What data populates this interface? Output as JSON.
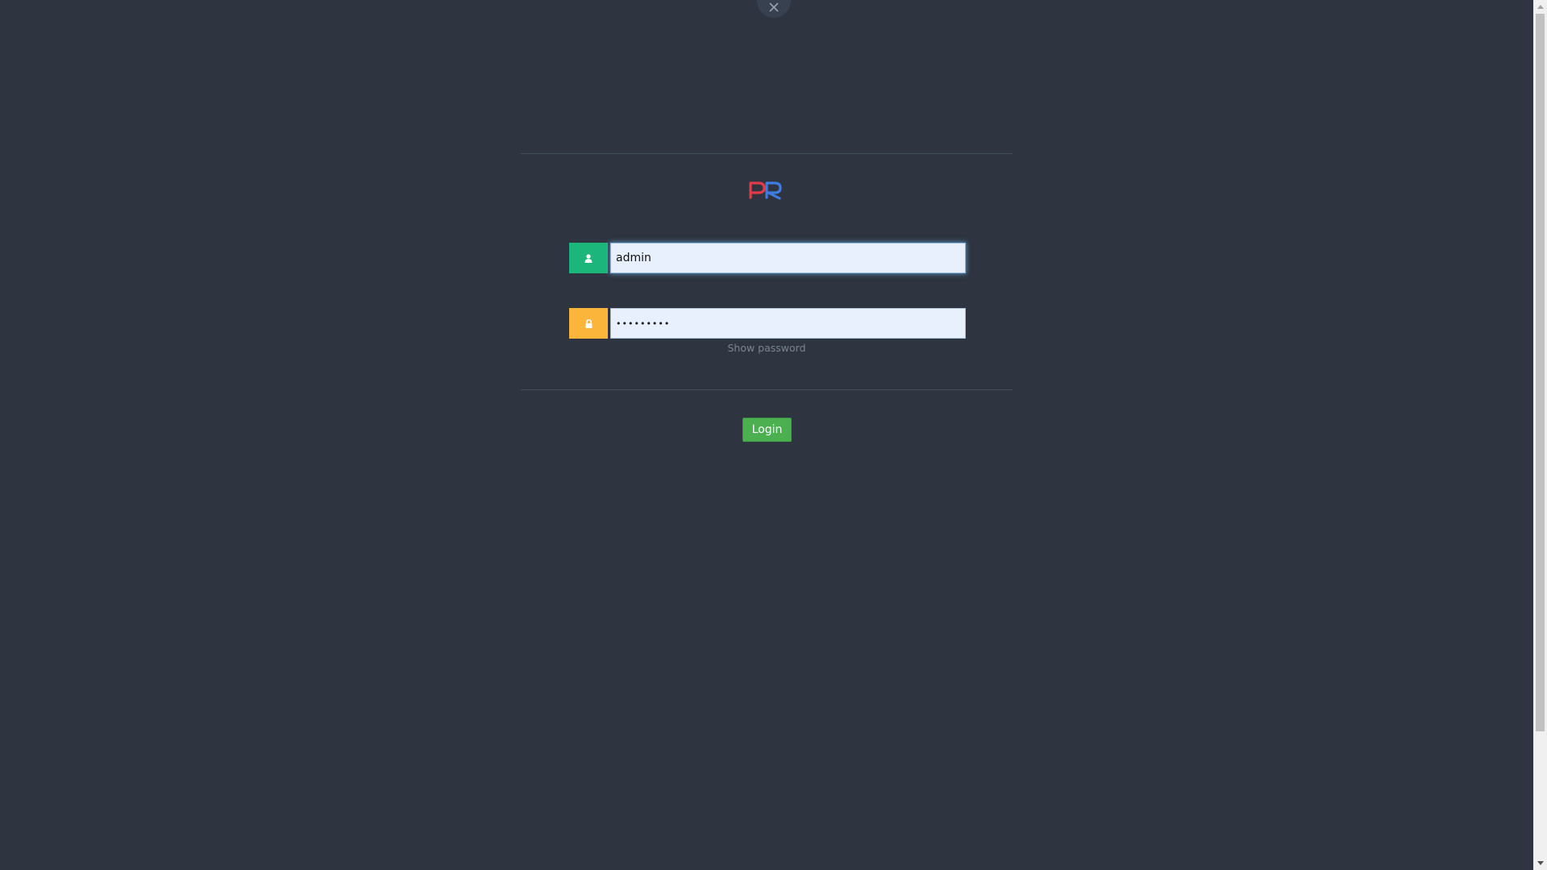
{
  "close_button": {
    "icon": "close-icon"
  },
  "logo": {
    "text": "PR",
    "colors": [
      "#e23b4a",
      "#3f7be0"
    ]
  },
  "username": {
    "value": "admin",
    "icon": "user-icon",
    "accent": "#1cb57a"
  },
  "password": {
    "value": "•••••••••",
    "icon": "lock-icon",
    "accent": "#fcb53b"
  },
  "show_password_label": "Show password",
  "login_label": "Login",
  "colors": {
    "background": "#2e3540",
    "login_button": "#4caf50",
    "input_bg": "#e8f0fe"
  }
}
